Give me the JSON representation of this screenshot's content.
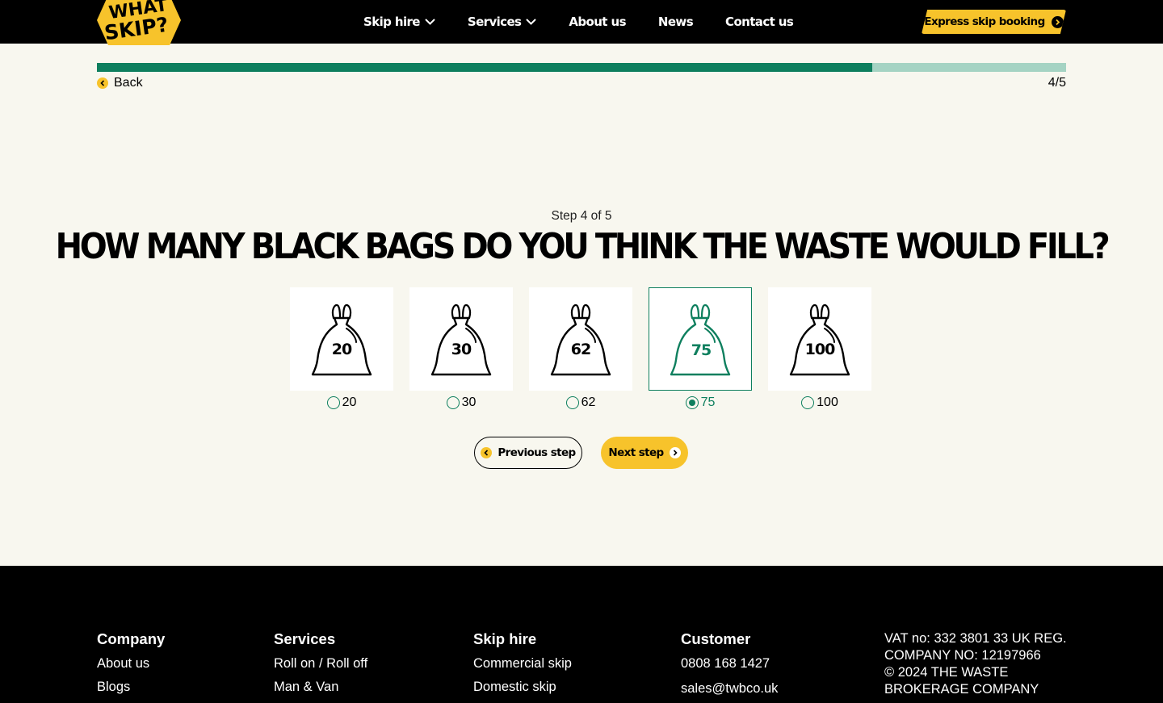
{
  "brand": {
    "logo_text_line1": "WHAT",
    "logo_text_line2": "SKIP?",
    "accent": "#f7c32b",
    "green": "#0e7f5e"
  },
  "nav": {
    "items": [
      {
        "label": "Skip hire",
        "has_dropdown": true
      },
      {
        "label": "Services",
        "has_dropdown": true
      },
      {
        "label": "About us",
        "has_dropdown": false
      },
      {
        "label": "News",
        "has_dropdown": false
      },
      {
        "label": "Contact us",
        "has_dropdown": false
      }
    ],
    "cta_label": "Express skip booking"
  },
  "progress": {
    "fraction": 0.8,
    "back_label": "Back",
    "count_text": "4/5"
  },
  "question": {
    "step_text": "Step 4 of 5",
    "title": "HOW MANY BLACK BAGS DO YOU THINK THE WASTE WOULD FILL?"
  },
  "options": [
    {
      "value": "20",
      "label": "20",
      "selected": false
    },
    {
      "value": "30",
      "label": "30",
      "selected": false
    },
    {
      "value": "62",
      "label": "62",
      "selected": false
    },
    {
      "value": "75",
      "label": "75",
      "selected": true
    },
    {
      "value": "100",
      "label": "100",
      "selected": false
    }
  ],
  "buttons": {
    "previous_label": "Previous step",
    "next_label": "Next step"
  },
  "footer": {
    "company": {
      "heading": "Company",
      "links": [
        "About us",
        "Blogs"
      ]
    },
    "services": {
      "heading": "Services",
      "links": [
        "Roll on / Roll off",
        "Man & Van"
      ]
    },
    "skip_hire": {
      "heading": "Skip hire",
      "links": [
        "Commercial skip",
        "Domestic skip"
      ]
    },
    "customer": {
      "heading": "Customer",
      "phone": "0808 168 1427",
      "email": "sales@twbco.uk"
    },
    "legal_text": "VAT no: 332 3801 33 UK REG.\nCOMPANY NO: 12197966\n© 2024 THE WASTE\nBROKERAGE COMPANY"
  }
}
